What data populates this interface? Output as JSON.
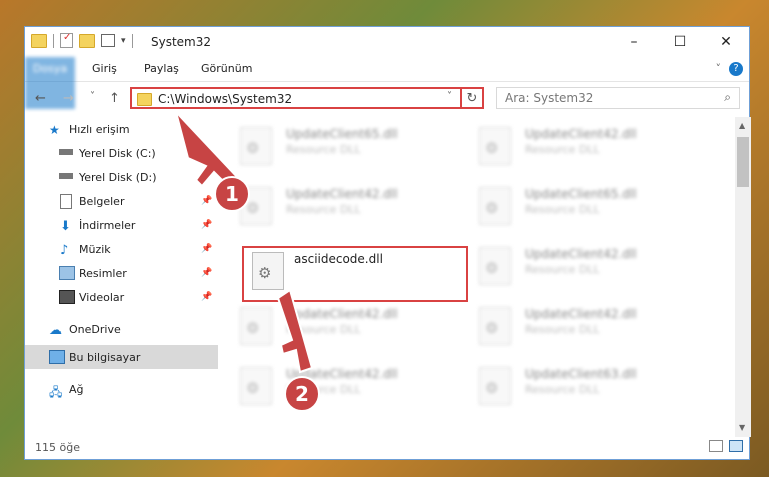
{
  "window": {
    "title": "System32"
  },
  "ribbon": {
    "tabs": [
      "Dosya",
      "Giriş",
      "Paylaş",
      "Görünüm"
    ],
    "help": "?"
  },
  "nav": {
    "back": "←",
    "forward": "→",
    "recent": "˅",
    "up": "↑"
  },
  "address": {
    "path": "C:\\Windows\\System32",
    "dropdown": "˅",
    "refresh": "↻"
  },
  "search": {
    "placeholder": "Ara: System32",
    "icon": "search-icon"
  },
  "sidebar": {
    "items": [
      {
        "label": "Hızlı erişim",
        "icon": "star-icon"
      },
      {
        "label": "Yerel Disk (C:)",
        "icon": "drive-icon",
        "pinned": true
      },
      {
        "label": "Yerel Disk (D:)",
        "icon": "drive-icon",
        "pinned": true
      },
      {
        "label": "Belgeler",
        "icon": "document-icon",
        "pinned": true
      },
      {
        "label": "İndirmeler",
        "icon": "download-icon",
        "pinned": true
      },
      {
        "label": "Müzik",
        "icon": "music-icon",
        "pinned": true
      },
      {
        "label": "Resimler",
        "icon": "pictures-icon",
        "pinned": true
      },
      {
        "label": "Videolar",
        "icon": "video-icon",
        "pinned": true
      },
      {
        "label": "OneDrive",
        "icon": "cloud-icon"
      },
      {
        "label": "Bu bilgisayar",
        "icon": "computer-icon",
        "selected": true
      },
      {
        "label": "Ağ",
        "icon": "network-icon"
      }
    ]
  },
  "files": [
    {
      "name": "UpdateClient65.dll",
      "type": "Resource DLL"
    },
    {
      "name": "UpdateClient42.dll",
      "type": "Resource DLL"
    },
    {
      "name": "UpdateClient42.dll",
      "type": "Resource DLL"
    },
    {
      "name": "UpdateClient65.dll",
      "type": "Resource DLL"
    },
    {
      "name": "asciidecode.dll",
      "type": ""
    },
    {
      "name": "UpdateClient42.dll",
      "type": "Resource DLL"
    },
    {
      "name": "UpdateClient42.dll",
      "type": "Resource DLL"
    },
    {
      "name": "UpdateClient42.dll",
      "type": "Resource DLL"
    },
    {
      "name": "UpdateClient42.dll",
      "type": "Resource DLL"
    },
    {
      "name": "UpdateClient63.dll",
      "type": "Resource DLL"
    }
  ],
  "status": {
    "count": "115 öğe"
  },
  "callouts": {
    "one": "1",
    "two": "2"
  },
  "colors": {
    "accent": "#1979ca",
    "highlight": "#d94242",
    "callout": "#c74444"
  }
}
